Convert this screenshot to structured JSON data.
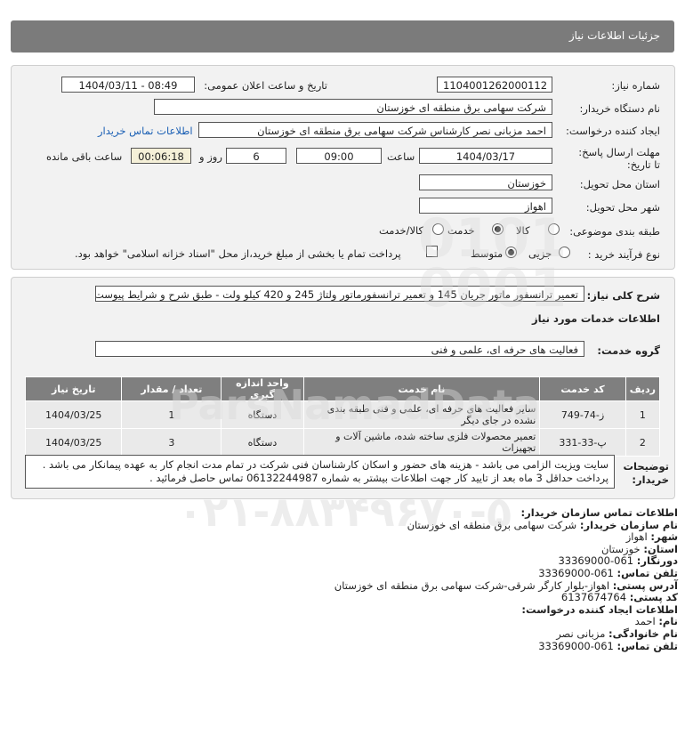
{
  "header": {
    "title": "جزئیات اطلاعات نیاز"
  },
  "form": {
    "need_number_label": "شماره نیاز:",
    "need_number": "1104001262000112",
    "announce_label": "تاریخ و ساعت اعلان عمومی:",
    "announce_value": "1404/03/11 - 08:49",
    "buyer_org_label": "نام دستگاه خریدار:",
    "buyer_org": "شرکت سهامی برق منطقه ای خوزستان",
    "requester_label": "ایجاد کننده درخواست:",
    "requester": "احمد مزبانی نصر کارشناس شرکت سهامی برق منطقه ای خوزستان",
    "contact_link": "اطلاعات تماس خریدار",
    "deadline_label": "مهلت ارسال پاسخ: تا تاریخ:",
    "deadline_date": "1404/03/17",
    "time_label": "ساعت",
    "deadline_time": "09:00",
    "days_value": "6",
    "days_label": "روز و",
    "remaining_value": "00:06:18",
    "remaining_label": "ساعت باقی مانده",
    "province_label": "استان محل تحویل:",
    "province": "خوزستان",
    "city_label": "شهر محل تحویل:",
    "city": "اهواز",
    "category_label": "طبقه بندی موضوعی:",
    "category_options": [
      "کالا",
      "خدمت",
      "کالا/خدمت"
    ],
    "category_selected": 1,
    "process_label": "نوع فرآیند خرید :",
    "process_options": [
      "جزیی",
      "متوسط"
    ],
    "process_selected": 1,
    "payment_note": "پرداخت تمام یا بخشی از مبلغ خرید،از محل \"اسناد خزانه اسلامی\" خواهد بود."
  },
  "details": {
    "summary_label": "شرح کلی نیاز:",
    "summary": "تعمیر ترانسفور ماتور جریان 145 و تعمیر ترانسفورماتور ولتاژ 245 و 420 کیلو ولت - طبق شرح و شرایط پیوست",
    "services_title": "اطلاعات خدمات مورد نیاز",
    "service_group_label": "گروه خدمت:",
    "service_group": "فعالیت های حرفه ای، علمی و فنی",
    "table": {
      "headers": [
        "ردیف",
        "کد خدمت",
        "نام خدمت",
        "واحد اندازه گیری",
        "تعداد / مقدار",
        "تاریخ نیاز"
      ],
      "rows": [
        [
          "1",
          "ز-74-749",
          "سایر فعالیت های حرفه ای، علمی و فنی طبقه بندی نشده در جای دیگر",
          "دستگاه",
          "1",
          "1404/03/25"
        ],
        [
          "2",
          "پ-33-331",
          "تعمیر محصولات فلزی ساخته شده، ماشین آلات و تجهیزات",
          "دستگاه",
          "3",
          "1404/03/25"
        ]
      ]
    },
    "buyer_notes_label": "توضیحات خریدار:",
    "buyer_notes": "سایت ویزیت الزامی می باشد - هزینه های حضور و اسکان کارشناسان فنی شرکت در تمام مدت انجام کار به عهده پیمانکار می باشد . پرداخت حداقل 3 ماه بعد از تایید کار جهت اطلاعات بیشتر به شماره 06132244987 تماس حاصل فرمائید ."
  },
  "contact": {
    "title": "اطلاعات تماس سازمان خریدار:",
    "org_label": "نام سازمان خریدار:",
    "org": "شرکت سهامی برق منطقه ای خوزستان",
    "city_label": "شهر:",
    "city": "اهواز",
    "province_label": "استان:",
    "province": "خوزستان",
    "fax_label": "دورنگار:",
    "fax": "061-33369000",
    "phone_label": "تلفن تماس:",
    "phone": "061-33369000",
    "address_label": "آدرس پستی:",
    "address": "اهواز-بلوار کارگر شرقی-شرکت سهامی برق منطقه ای خوزستان",
    "postal_label": "کد پستی:",
    "postal": "6137674764",
    "creator_title": "اطلاعات ایجاد کننده درخواست:",
    "first_name_label": "نام:",
    "first_name": "احمد",
    "last_name_label": "نام خانوادگی:",
    "last_name": "مزبانی نصر",
    "creator_phone_label": "تلفن تماس:",
    "creator_phone": "061-33369000"
  },
  "watermark": {
    "name": "ParsNamadData",
    "phone": "۰۲۱-۸۸۳۴۹۶۷۰-۵"
  }
}
